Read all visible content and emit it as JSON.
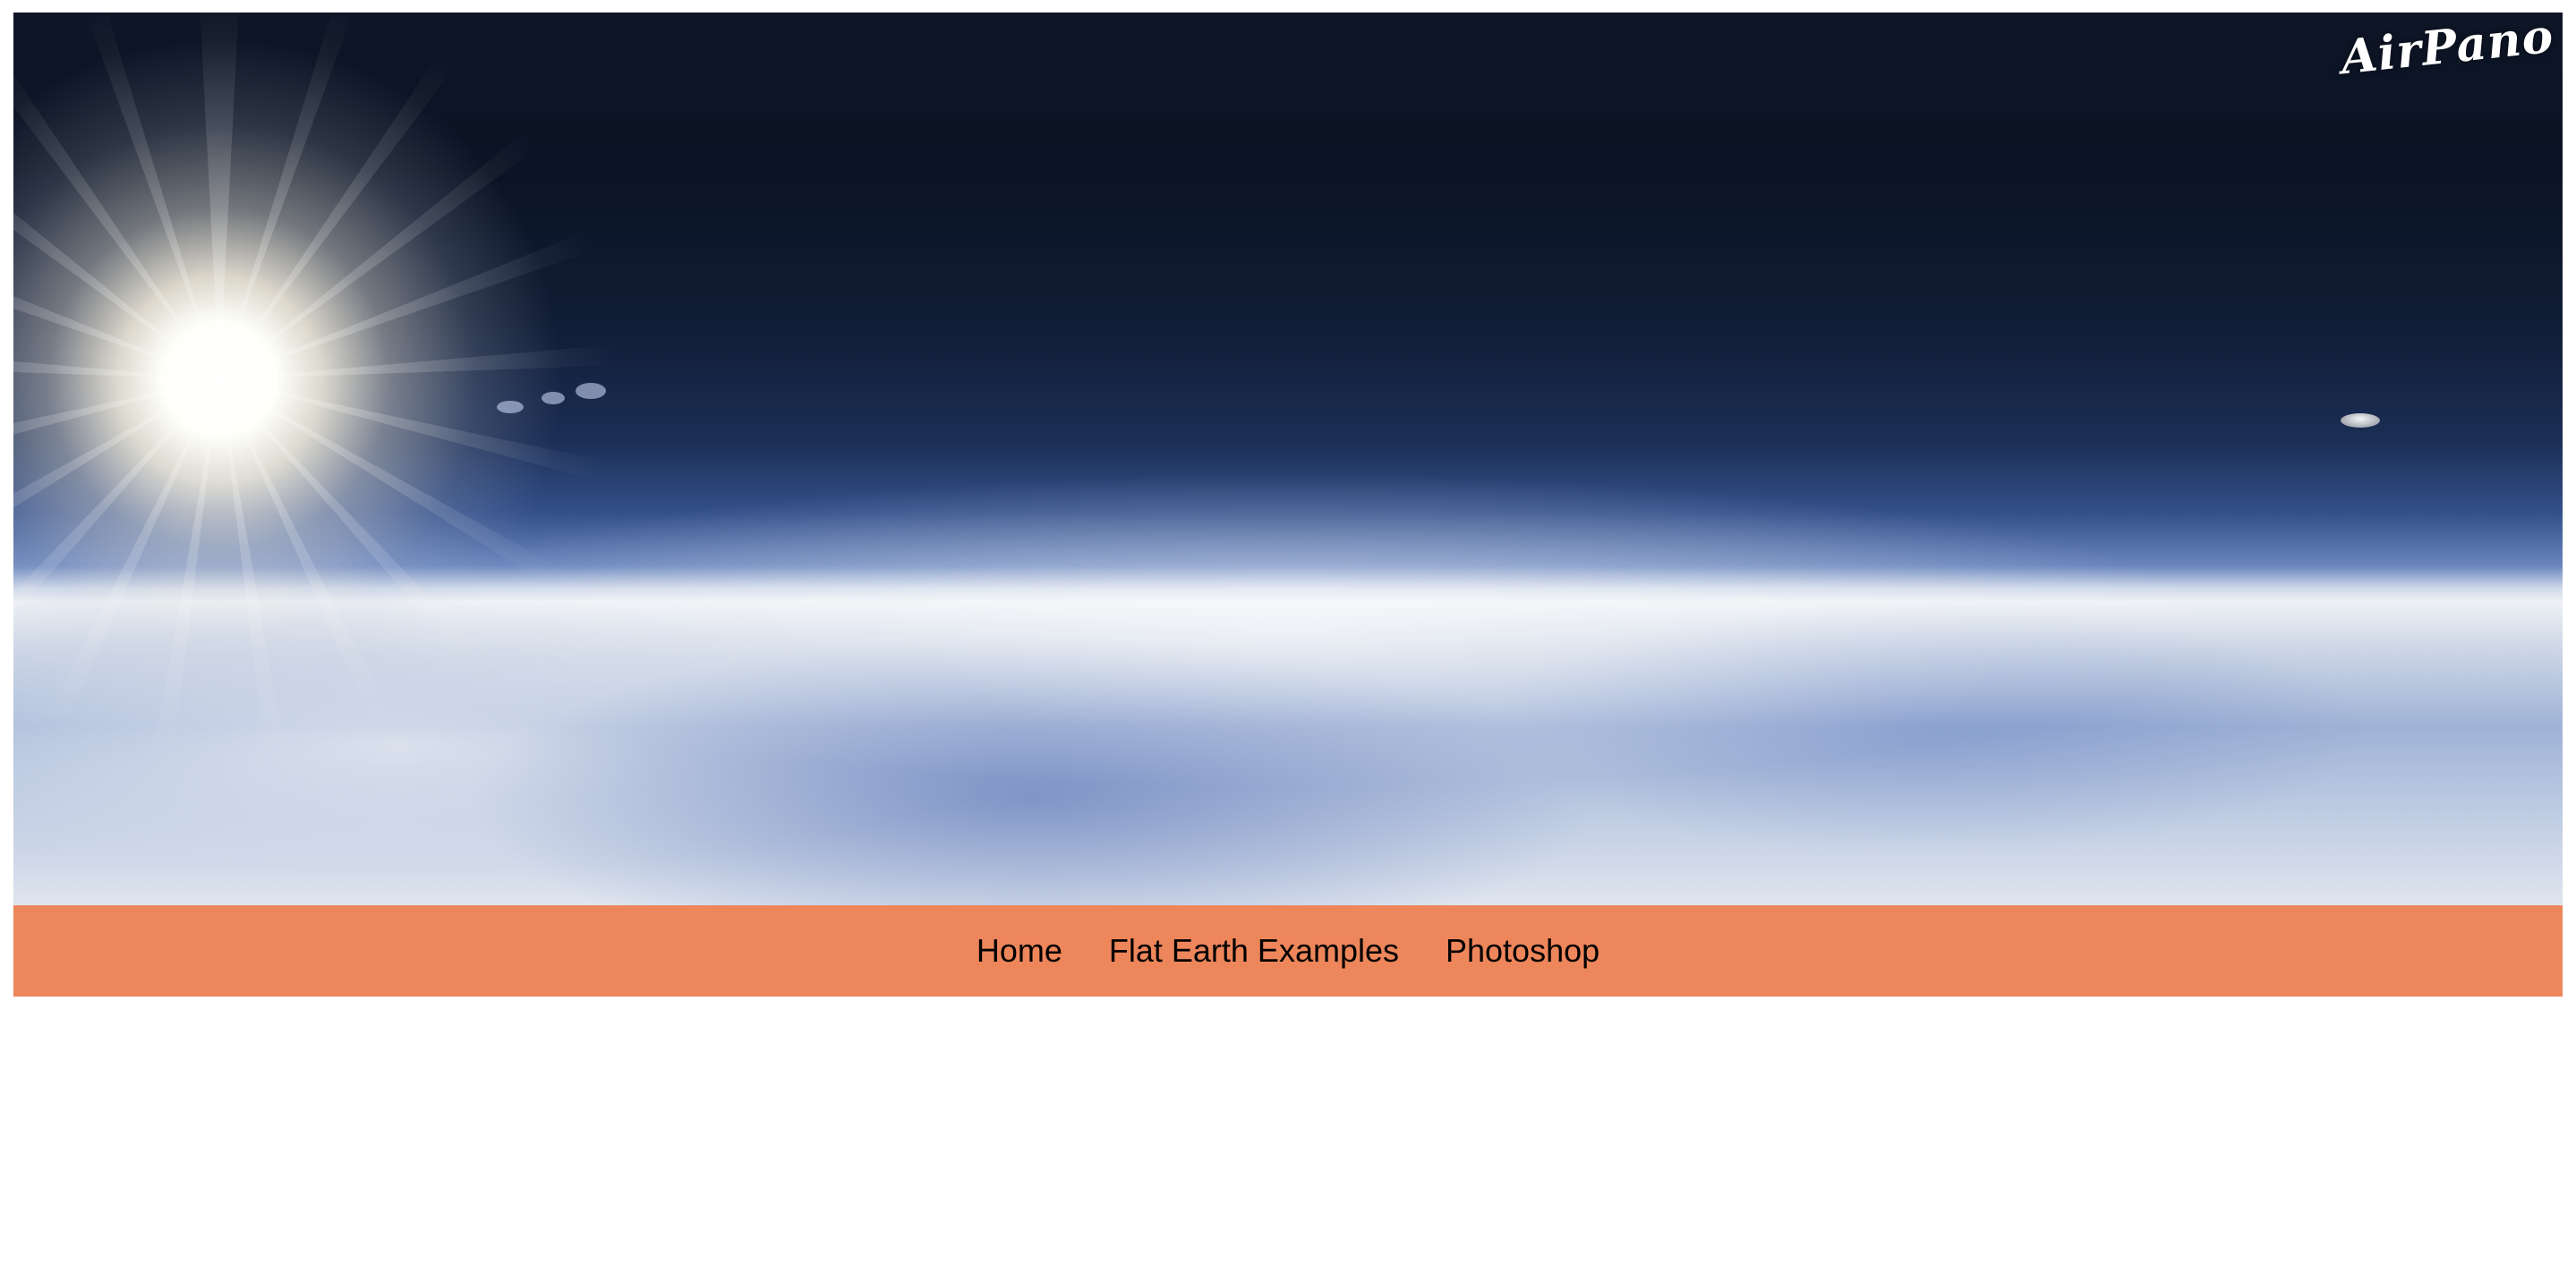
{
  "hero": {
    "watermark_text": "AirPano",
    "image_description_icon": "stratosphere-panorama"
  },
  "nav": {
    "items": [
      {
        "label": "Home"
      },
      {
        "label": "Flat Earth Examples"
      },
      {
        "label": "Photoshop"
      }
    ],
    "background_color": "#ee865b"
  }
}
